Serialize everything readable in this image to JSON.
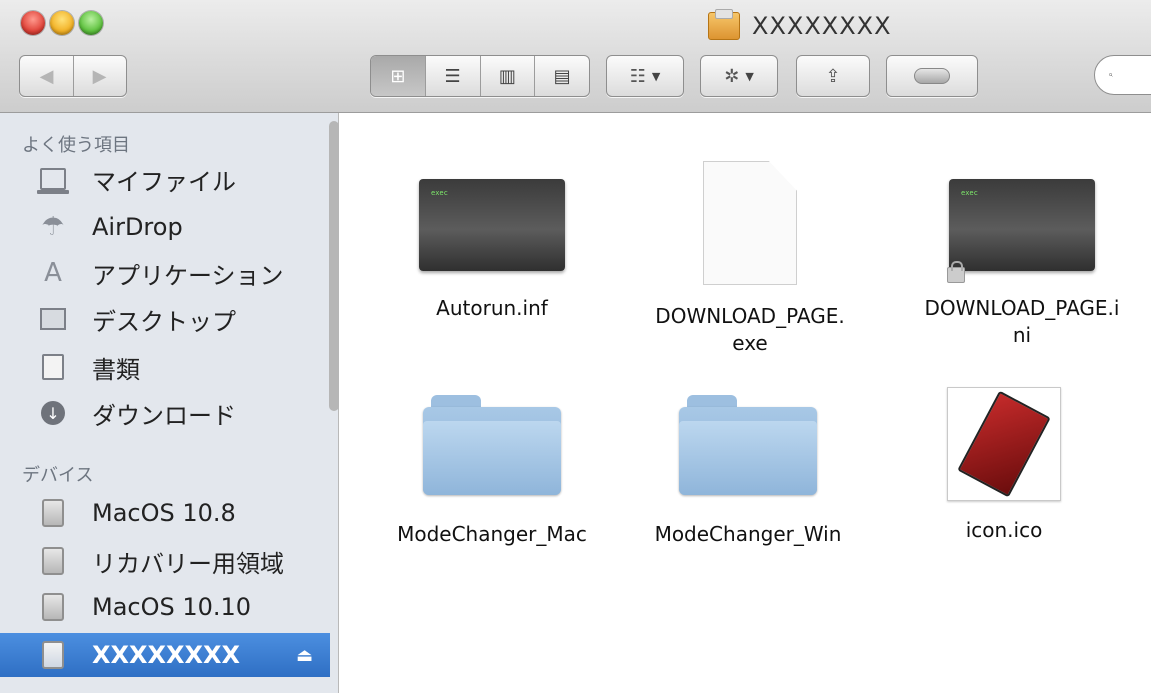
{
  "window": {
    "title": "XXXXXXXX"
  },
  "toolbar": {
    "nav_back": "◀",
    "nav_forward": "▶",
    "view_icon": "⊞",
    "view_list": "☰",
    "view_columns": "▥",
    "view_coverflow": "▤",
    "arrange": "☷",
    "action": "✲",
    "dropdown_caret": "▼",
    "share": "⇪",
    "search_placeholder": ""
  },
  "sidebar": {
    "favorites_header": "よく使う項目",
    "favorites": [
      {
        "label": "マイファイル",
        "icon": "myfiles-icon"
      },
      {
        "label": "AirDrop",
        "icon": "airdrop-icon"
      },
      {
        "label": "アプリケーション",
        "icon": "applications-icon"
      },
      {
        "label": "デスクトップ",
        "icon": "desktop-icon"
      },
      {
        "label": "書類",
        "icon": "documents-icon"
      },
      {
        "label": "ダウンロード",
        "icon": "downloads-icon"
      }
    ],
    "devices_header": "デバイス",
    "devices": [
      {
        "label": "MacOS 10.8",
        "icon": "disk-icon"
      },
      {
        "label": "リカバリー用領域",
        "icon": "disk-icon"
      },
      {
        "label": "MacOS 10.10",
        "icon": "disk-icon"
      },
      {
        "label": "XXXXXXXX",
        "icon": "disk-icon",
        "selected": true,
        "eject": "⏏"
      }
    ]
  },
  "files": [
    {
      "name": "Autorun.inf",
      "kind": "exec",
      "badge": "exec"
    },
    {
      "name": "DOWNLOAD_PAGE.\nexe",
      "kind": "document"
    },
    {
      "name": "DOWNLOAD_PAGE.i\nni",
      "kind": "exec-locked",
      "badge": "exec"
    },
    {
      "name": "ModeChanger_Mac",
      "kind": "folder"
    },
    {
      "name": "ModeChanger_Win",
      "kind": "folder"
    },
    {
      "name": "icon.ico",
      "kind": "image"
    }
  ],
  "colors": {
    "selection": "#3b7bd0",
    "sidebar_bg": "#e3e7ed",
    "folder": "#9dbfe0"
  }
}
